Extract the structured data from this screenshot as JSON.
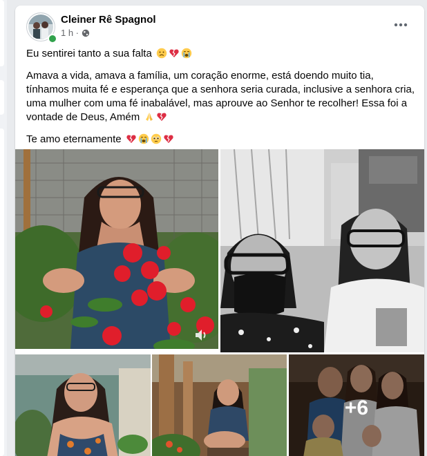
{
  "post": {
    "author": "Cleiner Rê Spagnol",
    "time": "1 h ·",
    "paragraphs": [
      {
        "text": "Eu sentirei tanto a sua falta",
        "emojis": [
          "sad-face",
          "broken-heart",
          "crying-face"
        ]
      },
      {
        "text": "Amava a vida, amava a família, um coração enorme, está doendo muito tia, tínhamos muita fé e esperança que a senhora seria curada, inclusive a senhora cria, uma mulher com uma fé inabalável, mas aprouve ao Senhor te recolher! Essa foi a vontade de Deus, Amém",
        "emojis": [
          "praying-hands",
          "broken-heart"
        ]
      },
      {
        "text": "Te amo eternamente",
        "emojis": [
          "broken-heart",
          "crying-face",
          "pleading-face",
          "broken-heart"
        ]
      }
    ],
    "more_photos_count": "+6"
  },
  "colors": {
    "card_bg": "#ffffff",
    "page_bg": "#e9ebee",
    "text": "#050505",
    "secondary_text": "#65676b",
    "online": "#31a24c"
  },
  "icons": [
    "more-options-icon",
    "globe-icon",
    "volume-icon",
    "online-status-icon"
  ]
}
